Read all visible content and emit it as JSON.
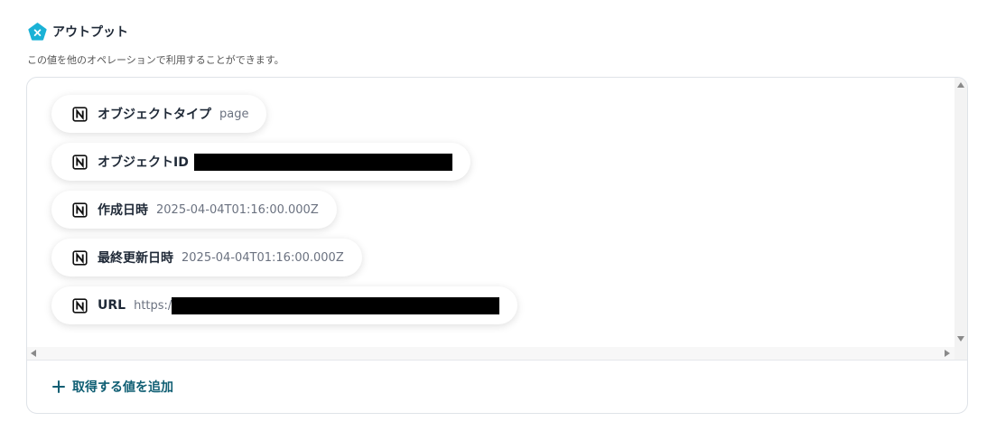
{
  "header": {
    "title": "アウトプット",
    "icon": "yoom-pentagon-icon",
    "icon_color": "#1ab2d6"
  },
  "subtitle": "この値を他のオペレーションで利用することができます。",
  "outputs": [
    {
      "label": "オブジェクトタイプ",
      "value": "page",
      "icon": "notion-icon",
      "redacted": false
    },
    {
      "label": "オブジェクトID",
      "value": "",
      "icon": "notion-icon",
      "redacted": true
    },
    {
      "label": "作成日時",
      "value": "2025-04-04T01:16:00.000Z",
      "icon": "notion-icon",
      "redacted": false
    },
    {
      "label": "最終更新日時",
      "value": "2025-04-04T01:16:00.000Z",
      "icon": "notion-icon",
      "redacted": false
    },
    {
      "label": "URL",
      "value": "https:/",
      "icon": "notion-icon",
      "redacted": true
    }
  ],
  "add_button": {
    "label": "取得する値を追加",
    "icon": "plus-icon",
    "color": "#0f5e73"
  }
}
